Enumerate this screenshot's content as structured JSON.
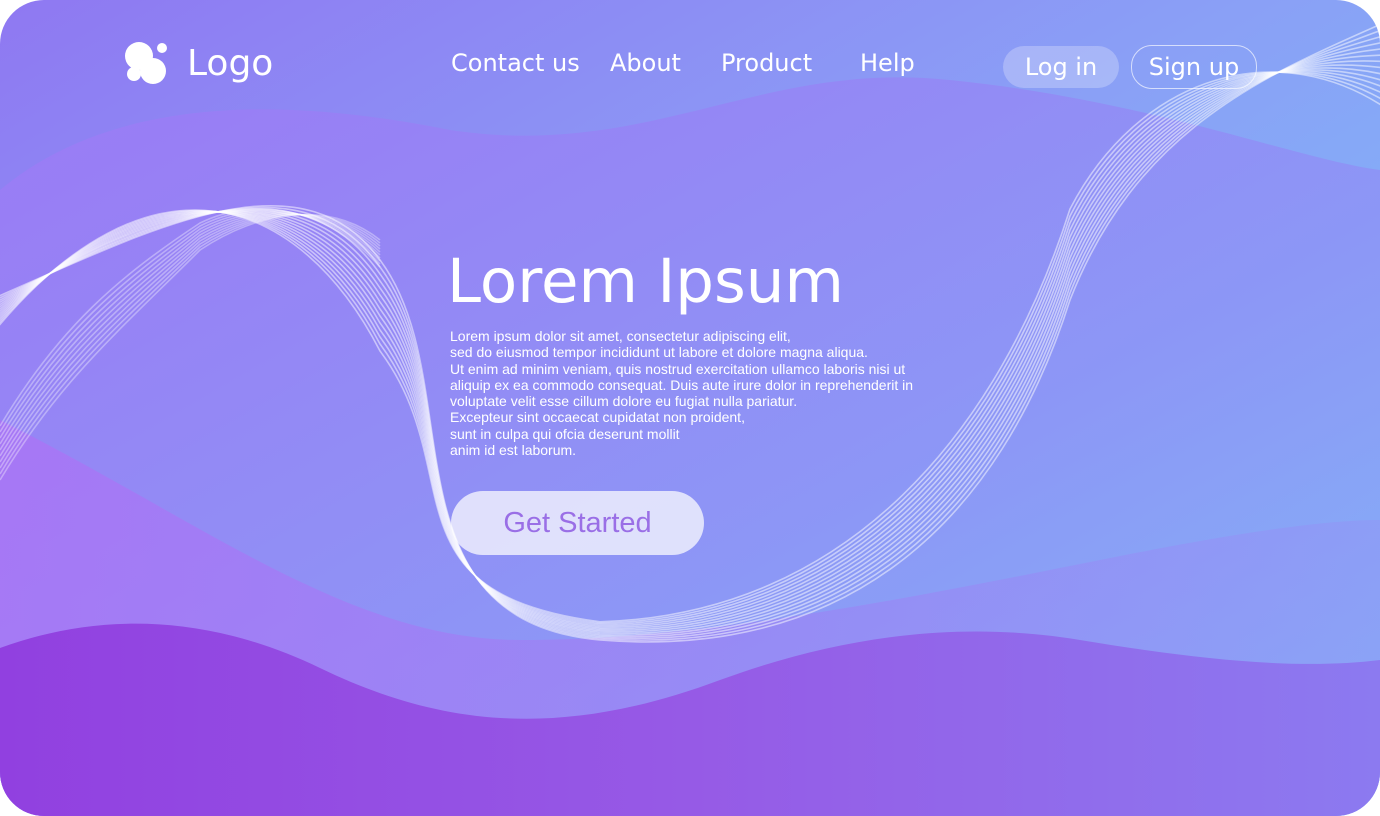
{
  "brand": {
    "logo_text": "Logo",
    "icon": "bubbles-logo-icon"
  },
  "nav": {
    "items": [
      {
        "label": "Contact us"
      },
      {
        "label": "About"
      },
      {
        "label": "Product"
      },
      {
        "label": "Help"
      }
    ],
    "login_label": "Log in",
    "signup_label": "Sign up"
  },
  "hero": {
    "title": "Lorem Ipsum",
    "body_lines": [
      "Lorem ipsum dolor sit amet, consectetur adipiscing elit,",
      "sed do eiusmod tempor incididunt ut labore et dolore magna aliqua.",
      "Ut enim ad minim veniam, quis nostrud exercitation ullamco laboris nisi ut",
      "aliquip ex ea commodo consequat. Duis aute irure dolor in reprehenderit in",
      "voluptate velit esse cillum dolore eu fugiat nulla pariatur.",
      "Excepteur sint occaecat cupidatat non proident,",
      "sunt in culpa qui ofcia deserunt mollit",
      "anim id est laborum."
    ],
    "cta_label": "Get Started"
  },
  "theme": {
    "gradient_start": "#8f78f2",
    "gradient_end": "#78c4fa",
    "wave_mid": "#9b7bf5",
    "wave_bottom": "#9246e0",
    "cta_text_color": "#9a6fe6",
    "text_color": "#ffffff"
  }
}
